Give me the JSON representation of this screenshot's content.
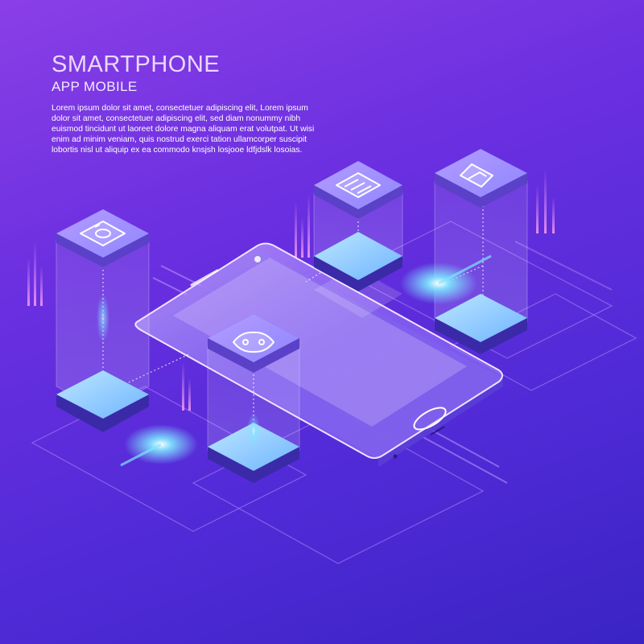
{
  "header": {
    "title": "SMARTPHONE",
    "subtitle": "APP MOBILE",
    "body": "Lorem ipsum dolor sit amet, consectetuer adipiscing elit, Lorem ipsum dolor sit amet, consectetuer adipiscing elit, sed diam nonummy nibh euismod tincidunt ut laoreet dolore magna aliquam erat volutpat. Ut wisi enim ad minim veniam, quis nostrud exerci tation ullamcorper suscipit lobortis nisl ut aliquip ex ea commodo knsjsh losjooe ldfjdslk losoias."
  },
  "icons": {
    "camera": "camera-icon",
    "calendar": "calendar-icon",
    "home": "home-icon",
    "gamepad": "gamepad-icon"
  },
  "colors": {
    "background_start": "#8a3fe6",
    "background_end": "#3a24c4",
    "glow": "#7ee6ff",
    "tile_top": "#9ea8ff",
    "tile_side": "#3a2aa8"
  }
}
